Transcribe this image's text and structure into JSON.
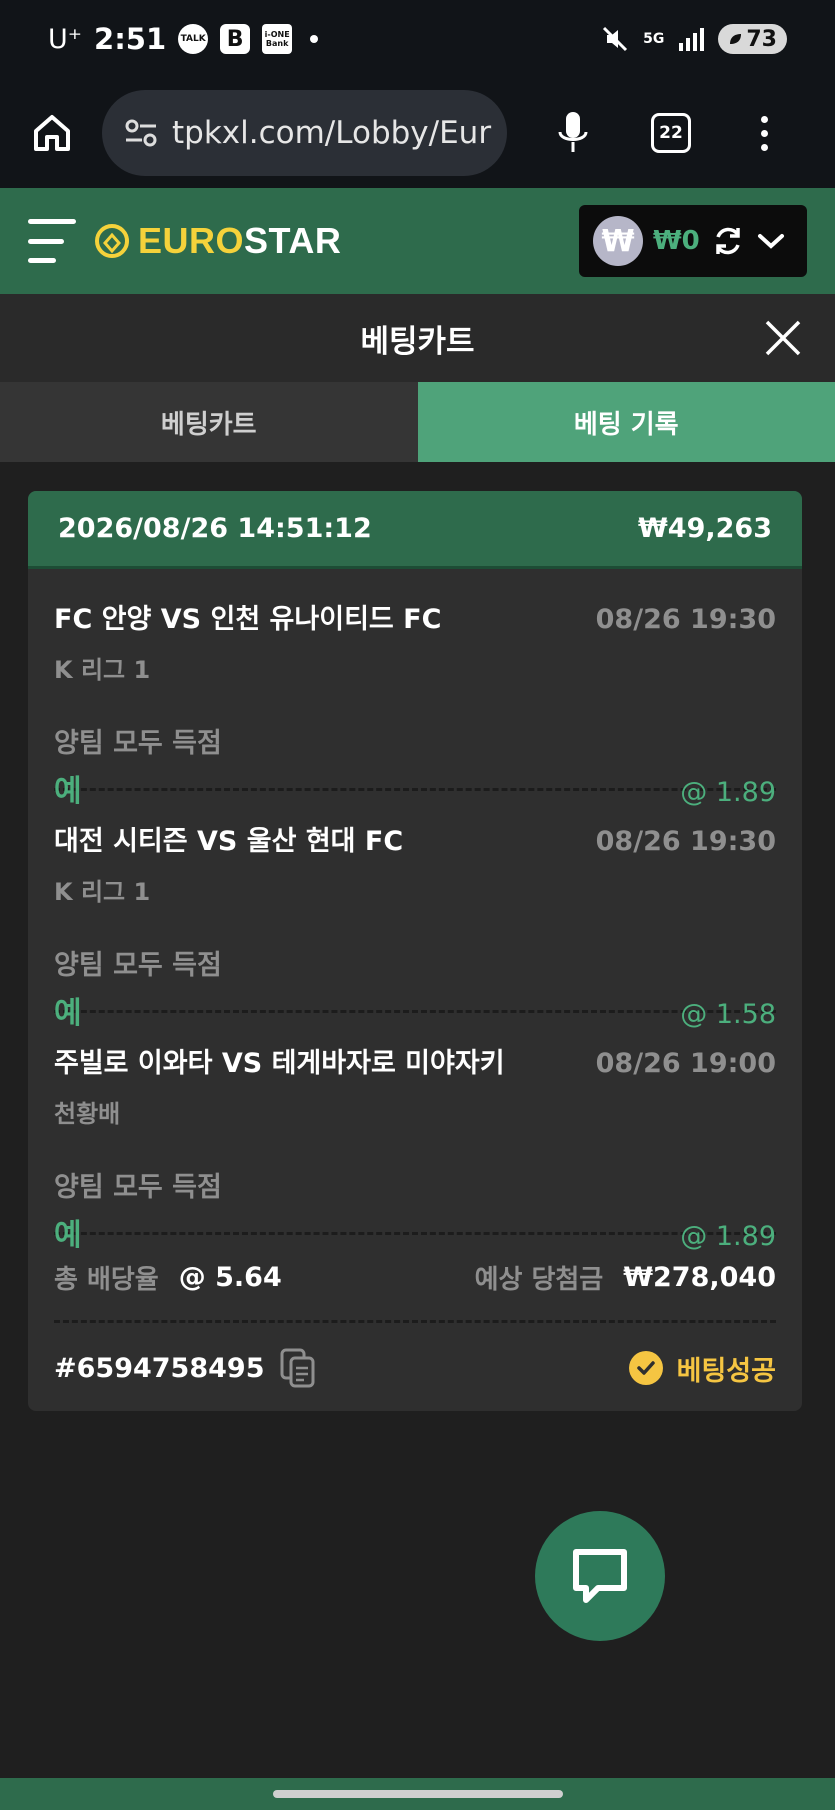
{
  "status_bar": {
    "carrier": "U⁺",
    "time": "2:51",
    "app_icons": [
      "TALK",
      "B",
      "i-ONE Bank"
    ],
    "network": "5G",
    "battery": "73"
  },
  "browser": {
    "url": "tpkxl.com/Lobby/Eur",
    "tab_count": "22"
  },
  "site": {
    "logo_euro": "EURO",
    "logo_star": "STAR",
    "wallet_symbol": "₩",
    "wallet_amount": "₩0"
  },
  "panel": {
    "title": "베팅카트",
    "tabs": [
      {
        "label": "베팅카트",
        "active": false
      },
      {
        "label": "베팅 기록",
        "active": true
      }
    ]
  },
  "bet": {
    "datetime": "2026/08/26 14:51:12",
    "stake": "₩49,263",
    "matches": [
      {
        "teams": "FC 안양 VS 인천 유나이티드 FC",
        "time": "08/26 19:30",
        "league": "K 리그 1",
        "market": "양팀 모두 득점",
        "pick": "예",
        "odds": "@ 1.89"
      },
      {
        "teams": "대전 시티즌 VS 울산 현대 FC",
        "time": "08/26 19:30",
        "league": "K 리그 1",
        "market": "양팀 모두 득점",
        "pick": "예",
        "odds": "@ 1.58"
      },
      {
        "teams": "주빌로 이와타 VS 테게바자로 미야자키",
        "time": "08/26 19:00",
        "league": "천황배",
        "market": "양팀 모두 득점",
        "pick": "예",
        "odds": "@ 1.89"
      }
    ],
    "total_odds_label": "총 배당율",
    "total_odds": "@ 5.64",
    "expected_win_label": "예상 당첨금",
    "expected_win": "₩278,040",
    "ticket_id": "#6594758495",
    "status": "베팅성공"
  },
  "colors": {
    "brand_green": "#2e6b4c",
    "accent_green": "#4caf7d",
    "gold": "#f5c542"
  }
}
